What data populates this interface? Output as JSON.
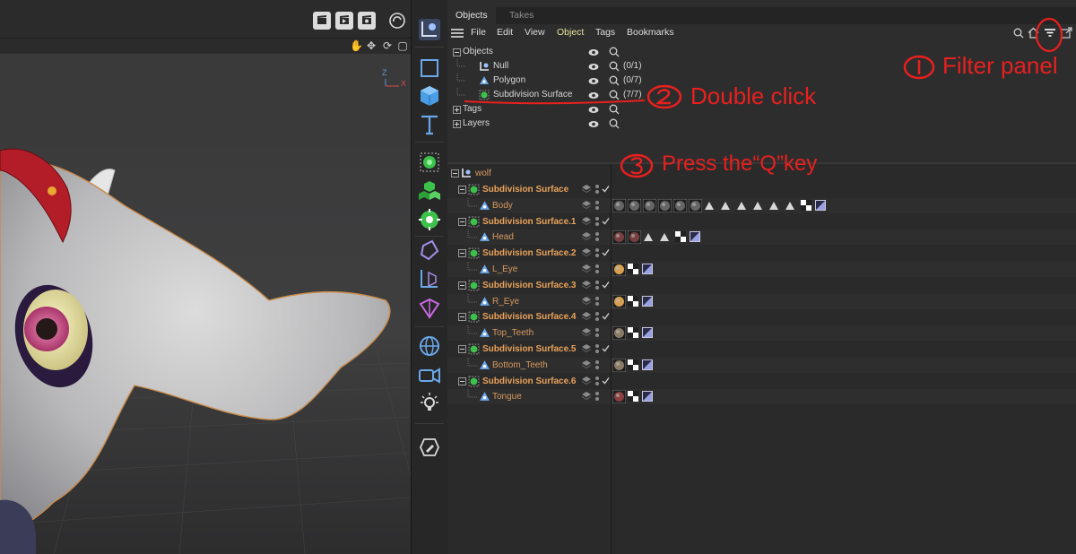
{
  "manager": {
    "tabs": [
      "Objects",
      "Takes"
    ],
    "menu": [
      "File",
      "Edit",
      "View",
      "Object",
      "Tags",
      "Bookmarks"
    ]
  },
  "filter_panel": {
    "rows": [
      {
        "label": "Objects",
        "count": ""
      },
      {
        "label": "Null",
        "count": "(0/1)"
      },
      {
        "label": "Polygon",
        "count": "(0/7)"
      },
      {
        "label": "Subdivision Surface",
        "count": "(7/7)"
      },
      {
        "label": "Tags",
        "count": ""
      },
      {
        "label": "Layers",
        "count": ""
      }
    ]
  },
  "tree": {
    "root": "wolf",
    "rows": [
      {
        "name": "Subdivision Surface",
        "type": "generator"
      },
      {
        "name": "Body",
        "type": "polygon"
      },
      {
        "name": "Subdivision Surface.1",
        "type": "generator"
      },
      {
        "name": "Head",
        "type": "polygon"
      },
      {
        "name": "Subdivision Surface.2",
        "type": "generator"
      },
      {
        "name": "L_Eye",
        "type": "polygon"
      },
      {
        "name": "Subdivision Surface.3",
        "type": "generator"
      },
      {
        "name": "R_Eye",
        "type": "polygon"
      },
      {
        "name": "Subdivision Surface.4",
        "type": "generator"
      },
      {
        "name": "Top_Teeth",
        "type": "polygon"
      },
      {
        "name": "Subdivision Surface.5",
        "type": "generator"
      },
      {
        "name": "Bottom_Teeth",
        "type": "polygon"
      },
      {
        "name": "Subdivision Surface.6",
        "type": "generator"
      },
      {
        "name": "Tongue",
        "type": "polygon"
      }
    ]
  },
  "viewport": {
    "axis_labels": [
      "Z",
      "X"
    ]
  },
  "annotations": {
    "step1": "Filter panel",
    "step2": "Double click",
    "step3": "Press the“Q”key"
  },
  "colors": {
    "accent_red": "#e8201e",
    "generator_orange": "#eaa35a",
    "menu_highlight": "#e9e09a"
  }
}
